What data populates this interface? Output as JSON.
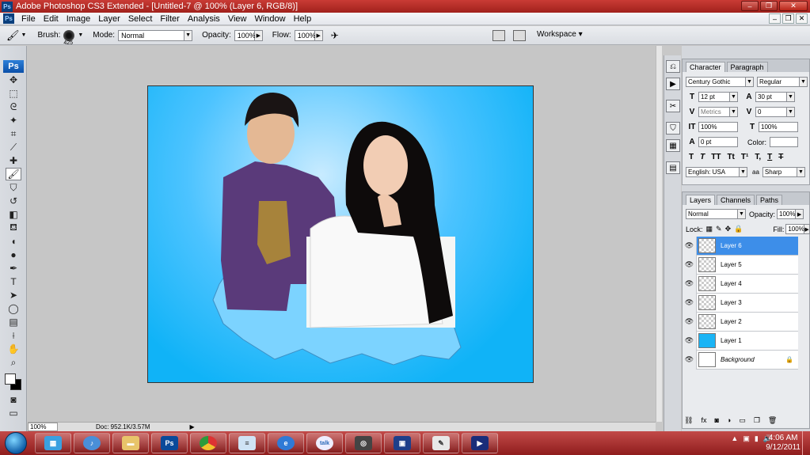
{
  "window": {
    "title": "Adobe Photoshop CS3 Extended - [Untitled-7 @ 100% (Layer 6, RGB/8)]",
    "app_icon": "Ps",
    "minimize": "–",
    "maximize": "❐",
    "close": "✕"
  },
  "menu": {
    "items": [
      "File",
      "Edit",
      "Image",
      "Layer",
      "Select",
      "Filter",
      "Analysis",
      "View",
      "Window",
      "Help"
    ],
    "doc_min": "–",
    "doc_restore": "❐",
    "doc_close": "✕"
  },
  "options": {
    "brush_label": "Brush:",
    "brush_size": "425",
    "mode_label": "Mode:",
    "mode_value": "Normal",
    "opacity_label": "Opacity:",
    "opacity_value": "100%",
    "flow_label": "Flow:",
    "flow_value": "100%",
    "workspace_label": "Workspace ▾"
  },
  "tools": {
    "logo": "Ps"
  },
  "status": {
    "zoom": "100%",
    "doc": "Doc: 952.1K/3.57M"
  },
  "character_panel": {
    "tabs": [
      "Character",
      "Paragraph"
    ],
    "font_family": "Century Gothic",
    "font_style": "Regular",
    "font_size": "12 pt",
    "leading": "30 pt",
    "kerning": "Metrics",
    "tracking": "0",
    "vertical_scale": "100%",
    "horizontal_scale": "100%",
    "baseline_shift": "0 pt",
    "color_label": "Color:",
    "language": "English: USA",
    "aa_label": "a",
    "antialias": "Sharp",
    "style_buttons": [
      "T",
      "T",
      "TT",
      "Tt",
      "T¹",
      "T,",
      "T",
      "T"
    ]
  },
  "layers_panel": {
    "tabs": [
      "Layers",
      "Channels",
      "Paths"
    ],
    "blend_mode": "Normal",
    "opacity_label": "Opacity:",
    "opacity_value": "100%",
    "lock_label": "Lock:",
    "fill_label": "Fill:",
    "fill_value": "100%",
    "layers": [
      {
        "name": "Layer 6",
        "selected": true
      },
      {
        "name": "Layer 5",
        "selected": false
      },
      {
        "name": "Layer 4",
        "selected": false
      },
      {
        "name": "Layer 3",
        "selected": false
      },
      {
        "name": "Layer 2",
        "selected": false
      },
      {
        "name": "Layer 1",
        "selected": false
      },
      {
        "name": "Background",
        "selected": false
      }
    ],
    "layer1_color": "#1ab4f5",
    "accent": "#3d8ee9"
  },
  "taskbar": {
    "apps": [
      "Ps",
      "talk"
    ],
    "time": "4:06 AM",
    "date": "9/12/2011"
  }
}
